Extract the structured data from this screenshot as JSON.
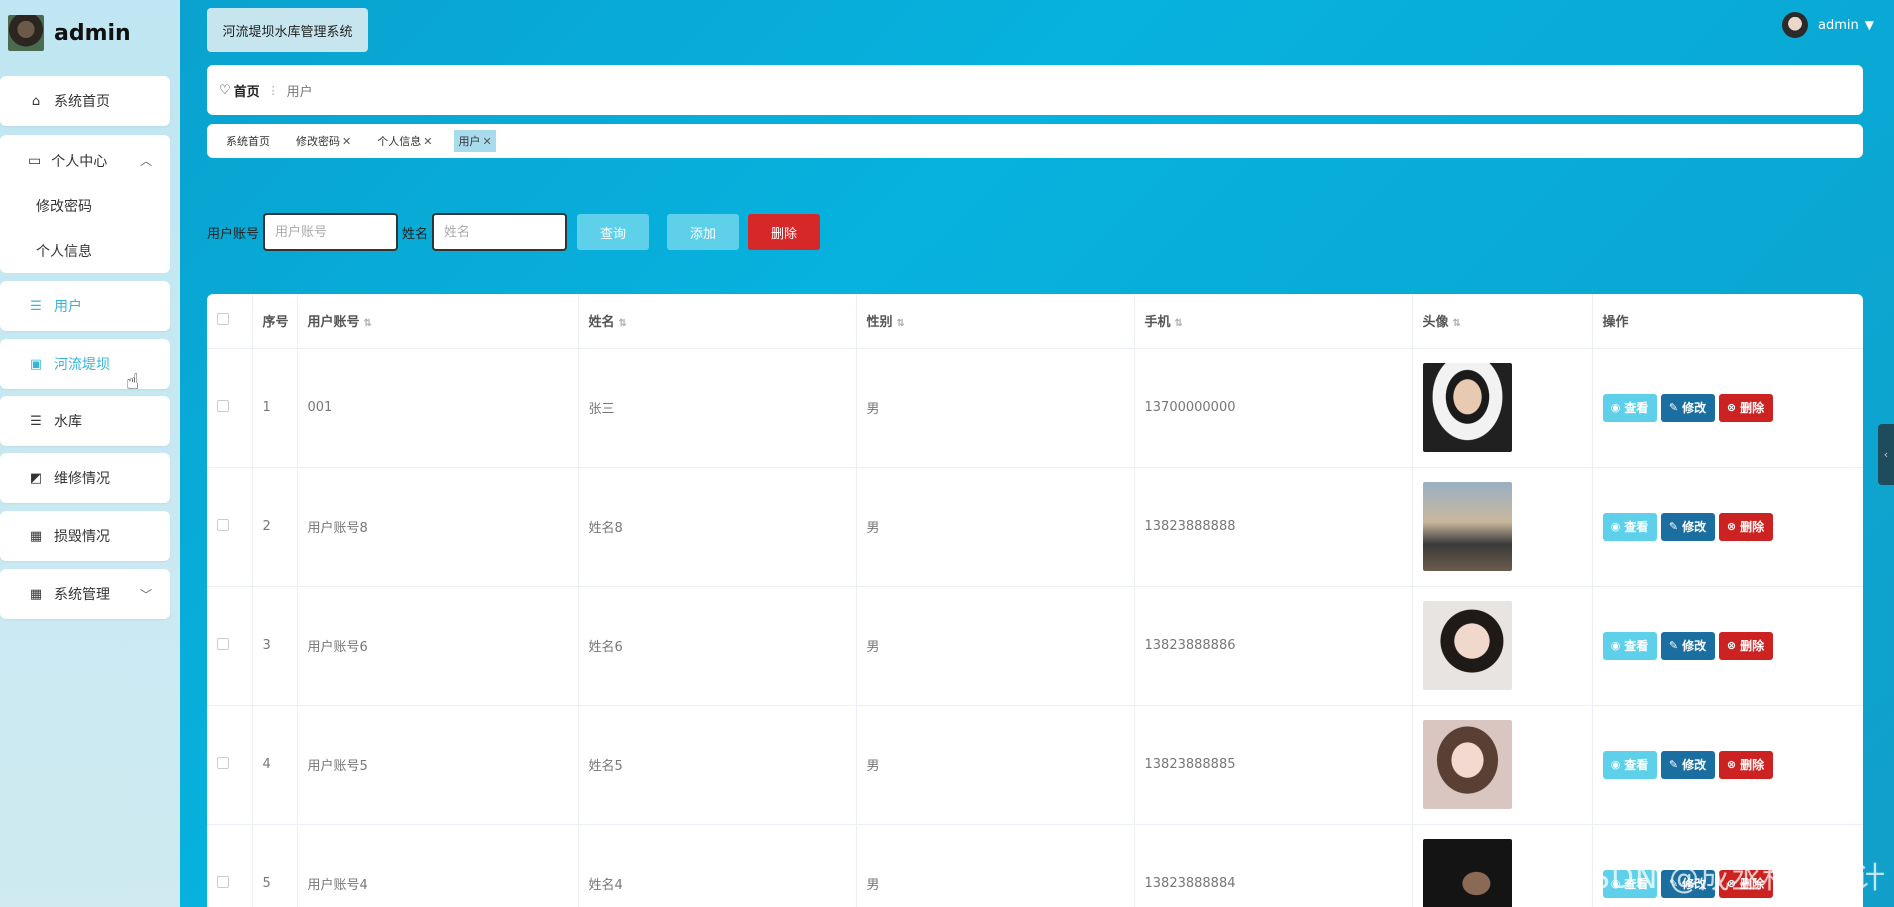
{
  "brand": {
    "name": "admin"
  },
  "topbar": {
    "system_title": "河流堤坝水库管理系统",
    "user_name": "admin"
  },
  "sidebar": {
    "items": [
      {
        "label": "系统首页",
        "icon": "home-icon"
      },
      {
        "label": "个人中心",
        "icon": "id-card-icon",
        "children": [
          "修改密码",
          "个人信息"
        ]
      },
      {
        "label": "用户",
        "icon": "list-icon"
      },
      {
        "label": "河流堤坝",
        "icon": "clipboard-icon"
      },
      {
        "label": "水库",
        "icon": "list-icon"
      },
      {
        "label": "维修情况",
        "icon": "chart-icon"
      },
      {
        "label": "损毁情况",
        "icon": "grid-icon"
      },
      {
        "label": "系统管理",
        "icon": "grid-icon"
      }
    ]
  },
  "breadcrumb": {
    "home": "首页",
    "current": "用户"
  },
  "tabs": [
    {
      "label": "系统首页",
      "closable": false
    },
    {
      "label": "修改密码",
      "closable": true
    },
    {
      "label": "个人信息",
      "closable": true
    },
    {
      "label": "用户",
      "closable": true,
      "active": true
    }
  ],
  "search": {
    "account_label": "用户账号",
    "account_placeholder": "用户账号",
    "name_label": "姓名",
    "name_placeholder": "姓名",
    "query_btn": "查询",
    "add_btn": "添加",
    "delete_btn": "删除"
  },
  "table": {
    "columns": [
      "序号",
      "用户账号",
      "姓名",
      "性别",
      "手机",
      "头像",
      "操作"
    ],
    "rows": [
      {
        "index": "1",
        "account": "001",
        "name": "张三",
        "gender": "男",
        "phone": "13700000000"
      },
      {
        "index": "2",
        "account": "用户账号8",
        "name": "姓名8",
        "gender": "男",
        "phone": "13823888888"
      },
      {
        "index": "3",
        "account": "用户账号6",
        "name": "姓名6",
        "gender": "男",
        "phone": "13823888886"
      },
      {
        "index": "4",
        "account": "用户账号5",
        "name": "姓名5",
        "gender": "男",
        "phone": "13823888885"
      },
      {
        "index": "5",
        "account": "用户账号4",
        "name": "姓名4",
        "gender": "男",
        "phone": "13823888884"
      }
    ],
    "ops": {
      "view": "查看",
      "edit": "修改",
      "delete": "删除"
    }
  },
  "watermark": "CSDN @成丞程序设计",
  "colors": {
    "accent": "#5ed0ea",
    "edit": "#1a6fa0",
    "danger": "#d62828",
    "background": "#07b2de"
  }
}
